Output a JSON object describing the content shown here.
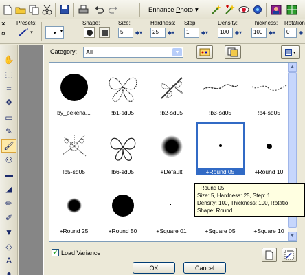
{
  "toolbar": {
    "icons": [
      "new-doc-icon",
      "open-icon",
      "copy-icon",
      "scissors-icon",
      "save-icon",
      "print-icon",
      "undo-icon",
      "redo-icon",
      "wand-icon",
      "wand-plus-icon",
      "red-eye-icon",
      "color-icon",
      "image-icon",
      "grid-icon"
    ],
    "enhance_pre": "Enhance ",
    "enhance_u": "P",
    "enhance_post": "hoto"
  },
  "options": {
    "presets_label": "Presets:",
    "shape_label": "Shape:",
    "size_label": "Size:",
    "hardness_label": "Hardness:",
    "step_label": "Step:",
    "density_label": "Density:",
    "thickness_label": "Thickness:",
    "rotation_label": "Rotation",
    "size_value": "5",
    "hardness_value": "25",
    "step_value": "1",
    "density_value": "100",
    "thickness_value": "100",
    "rotation_value": "0"
  },
  "dialog": {
    "category_label": "Category:",
    "category_value": "All",
    "load_variance_label": "Load Variance",
    "load_variance_checked": true,
    "ok_label": "OK",
    "cancel_label": "Cancel"
  },
  "brushes": [
    {
      "name": "by_pekena...",
      "kind": "disc-large"
    },
    {
      "name": "!b1-sd05",
      "kind": "butterfly"
    },
    {
      "name": "!b2-sd05",
      "kind": "dragonfly"
    },
    {
      "name": "!b3-sd05",
      "kind": "vine"
    },
    {
      "name": "!b4-sd05",
      "kind": "vine2"
    },
    {
      "name": "!b5-sd05",
      "kind": "splatter"
    },
    {
      "name": "!b6-sd05",
      "kind": "butterfly2"
    },
    {
      "name": "+Default",
      "kind": "soft"
    },
    {
      "name": "+Round 05",
      "kind": "dot-small",
      "selected": true
    },
    {
      "name": "+Round 10",
      "kind": "dot-med"
    },
    {
      "name": "+Round 25",
      "kind": "dot-25"
    },
    {
      "name": "+Round 50",
      "kind": "dot-50"
    },
    {
      "name": "+Square 01",
      "kind": "sq01"
    },
    {
      "name": "+Square 05",
      "kind": "sq05"
    },
    {
      "name": "+Square 10",
      "kind": "sq10"
    }
  ],
  "tooltip": {
    "line1": "+Round 05",
    "line2": "Size: 5, Hardness: 25, Step: 1",
    "line3": "Density: 100, Thickness: 100, Rotatio",
    "line4": "Shape: Round"
  }
}
